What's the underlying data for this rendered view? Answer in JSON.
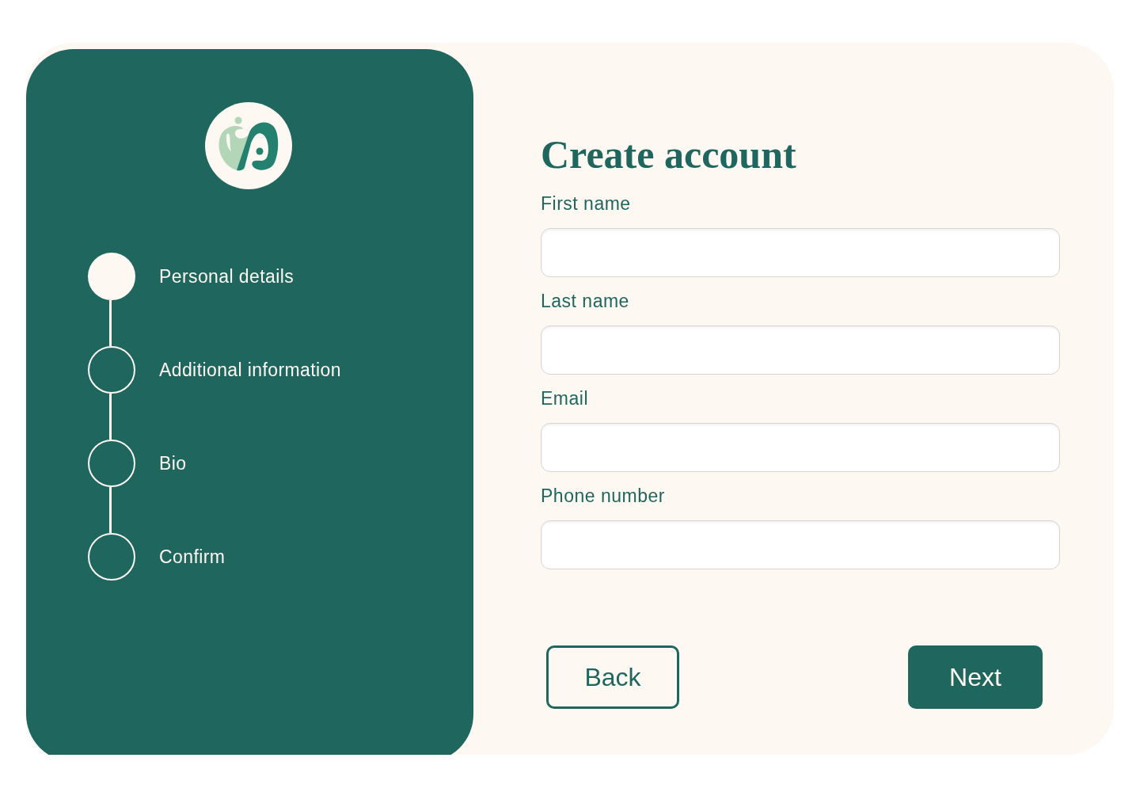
{
  "steps": [
    {
      "label": "Personal details",
      "selected": true
    },
    {
      "label": "Additional information",
      "selected": false
    },
    {
      "label": "Bio",
      "selected": false
    },
    {
      "label": "Confirm",
      "selected": false
    }
  ],
  "form": {
    "title": "Create account",
    "fields": [
      {
        "label": "First name"
      },
      {
        "label": "Last name"
      },
      {
        "label": "Email"
      },
      {
        "label": "Phone number"
      }
    ]
  },
  "buttons": [
    {
      "label": "Back",
      "kind": "outline"
    },
    {
      "label": "Next",
      "kind": "primary"
    }
  ]
}
